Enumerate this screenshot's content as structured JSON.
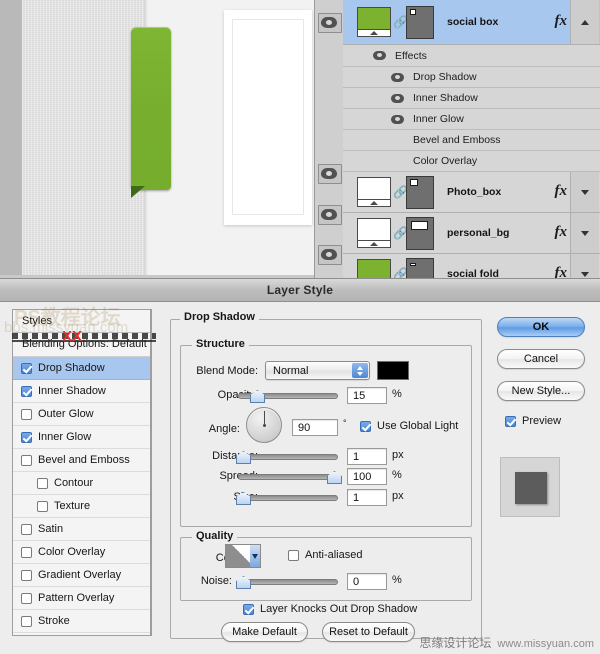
{
  "canvas": {
    "green_tab_color": "#7bb02f",
    "fold_color": "#3f6b16"
  },
  "layers_panel": {
    "layers": [
      {
        "name": "social box",
        "thumb": "green",
        "fx": "fx",
        "selected": true,
        "triangle": "up",
        "visible": true
      },
      {
        "name": "Photo_box",
        "thumb": "white",
        "fx": "fx",
        "selected": false,
        "triangle": "down",
        "visible": true
      },
      {
        "name": "personal_bg",
        "thumb": "white",
        "fx": "fx",
        "selected": false,
        "triangle": "down",
        "visible": true
      },
      {
        "name": "social fold",
        "thumb": "green",
        "fx": "fx",
        "selected": false,
        "triangle": "down",
        "visible": true
      }
    ],
    "effects_group_label": "Effects",
    "effects": [
      {
        "label": "Drop Shadow",
        "visible": true
      },
      {
        "label": "Inner Shadow",
        "visible": true
      },
      {
        "label": "Inner Glow",
        "visible": true
      },
      {
        "label": "Bevel and Emboss",
        "visible": false
      },
      {
        "label": "Color Overlay",
        "visible": false
      }
    ]
  },
  "dialog": {
    "title": "Layer Style",
    "styles_panel": {
      "header": "Styles",
      "blending_options": "Blending Options: Default",
      "items": [
        {
          "label": "Drop Shadow",
          "checked": true,
          "selected": true,
          "sub": false
        },
        {
          "label": "Inner Shadow",
          "checked": true,
          "selected": false,
          "sub": false
        },
        {
          "label": "Outer Glow",
          "checked": false,
          "selected": false,
          "sub": false
        },
        {
          "label": "Inner Glow",
          "checked": true,
          "selected": false,
          "sub": false
        },
        {
          "label": "Bevel and Emboss",
          "checked": false,
          "selected": false,
          "sub": false
        },
        {
          "label": "Contour",
          "checked": false,
          "selected": false,
          "sub": true
        },
        {
          "label": "Texture",
          "checked": false,
          "selected": false,
          "sub": true
        },
        {
          "label": "Satin",
          "checked": false,
          "selected": false,
          "sub": false
        },
        {
          "label": "Color Overlay",
          "checked": false,
          "selected": false,
          "sub": false
        },
        {
          "label": "Gradient Overlay",
          "checked": false,
          "selected": false,
          "sub": false
        },
        {
          "label": "Pattern Overlay",
          "checked": false,
          "selected": false,
          "sub": false
        },
        {
          "label": "Stroke",
          "checked": false,
          "selected": false,
          "sub": false
        }
      ]
    },
    "main": {
      "section_title": "Drop Shadow",
      "structure": {
        "legend": "Structure",
        "blend_mode_label": "Blend Mode:",
        "blend_mode_value": "Normal",
        "shadow_color": "#000000",
        "opacity_label": "Opacity:",
        "opacity_value": "15",
        "opacity_unit": "%",
        "angle_label": "Angle:",
        "angle_value": "90",
        "angle_unit": "°",
        "use_global_light_label": "Use Global Light",
        "use_global_light_checked": true,
        "distance_label": "Distance:",
        "distance_value": "1",
        "distance_unit": "px",
        "spread_label": "Spread:",
        "spread_value": "100",
        "spread_unit": "%",
        "size_label": "Size:",
        "size_value": "1",
        "size_unit": "px"
      },
      "quality": {
        "legend": "Quality",
        "contour_label": "Contour:",
        "anti_aliased_label": "Anti-aliased",
        "anti_aliased_checked": false,
        "noise_label": "Noise:",
        "noise_value": "0",
        "noise_unit": "%"
      },
      "knockout_label": "Layer Knocks Out Drop Shadow",
      "knockout_checked": true,
      "make_default": "Make Default",
      "reset_to_default": "Reset to Default"
    },
    "buttons": {
      "ok": "OK",
      "cancel": "Cancel",
      "new_style": "New Style...",
      "preview_label": "Preview",
      "preview_checked": true
    }
  },
  "watermark": {
    "cn": "思缘设计论坛",
    "url": "www.missyuan.com",
    "ghost_cn": "PS教程论坛",
    "ghost_url": "bbs.missyuan.com"
  }
}
